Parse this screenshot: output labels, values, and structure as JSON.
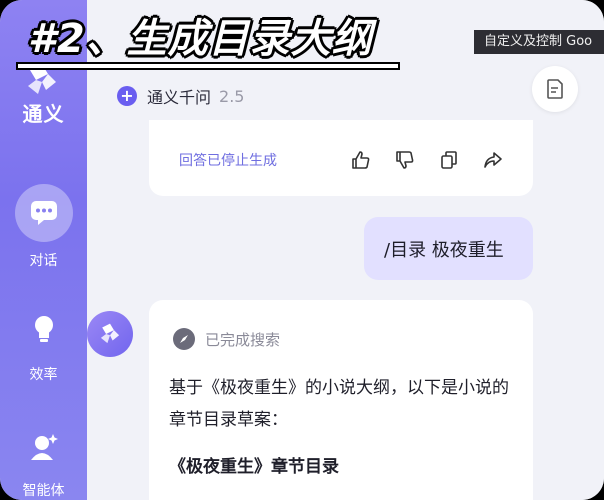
{
  "overlay": {
    "title": "#2、生成目录大纲"
  },
  "tooltip": {
    "text": "自定义及控制 Goo"
  },
  "sidebar": {
    "brand": "通义",
    "items": [
      {
        "label": "对话",
        "icon": "chat-icon",
        "active": true
      },
      {
        "label": "效率",
        "icon": "lightbulb-icon",
        "active": false
      },
      {
        "label": "智能体",
        "icon": "agent-icon",
        "active": false
      }
    ]
  },
  "header": {
    "model_name": "通义千问",
    "model_version": "2.5"
  },
  "previous_reply": {
    "status": "回答已停止生成",
    "actions": [
      "thumbs-up-icon",
      "thumbs-down-icon",
      "copy-icon",
      "share-icon"
    ]
  },
  "user_message": {
    "text": "/目录 极夜重生"
  },
  "ai_reply": {
    "search_status": "已完成搜索",
    "text": "基于《极夜重生》的小说大纲，以下是小说的章节目录草案：",
    "heading": "《极夜重生》章节目录"
  },
  "colors": {
    "accent": "#6a5ef0",
    "sidebar": "#8e82f2",
    "user_bubble": "#e2e0ff"
  }
}
